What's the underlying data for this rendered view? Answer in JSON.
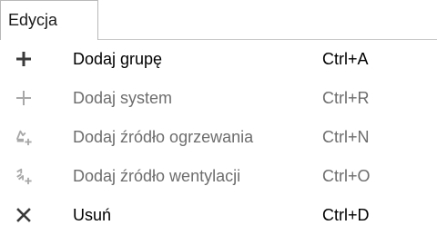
{
  "menu": {
    "title": "Edycja"
  },
  "items": [
    {
      "icon": "plus-icon",
      "label": "Dodaj grupę",
      "shortcut": "Ctrl+A",
      "enabled": true
    },
    {
      "icon": "plus-icon",
      "label": "Dodaj system",
      "shortcut": "Ctrl+R",
      "enabled": false
    },
    {
      "icon": "heat-source-add-icon",
      "label": "Dodaj źródło ogrzewania",
      "shortcut": "Ctrl+N",
      "enabled": false
    },
    {
      "icon": "ventilation-source-add-icon",
      "label": "Dodaj źródło wentylacji",
      "shortcut": "Ctrl+O",
      "enabled": false
    },
    {
      "icon": "delete-x-icon",
      "label": "Usuń",
      "shortcut": "Ctrl+D",
      "enabled": true
    }
  ],
  "colors": {
    "enabled_text": "#000000",
    "disabled_text": "#6d6d6d",
    "enabled_icon": "#3a3a3a",
    "disabled_icon": "#a8a8a8",
    "border": "#b8b8b8"
  }
}
